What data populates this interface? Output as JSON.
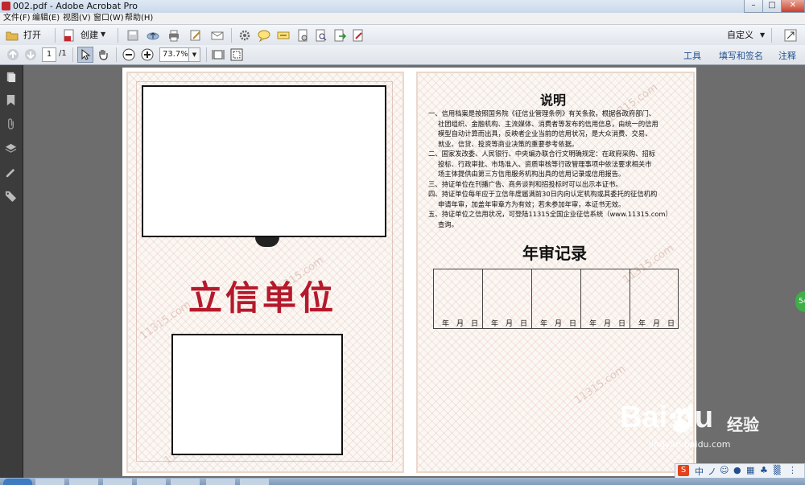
{
  "window": {
    "title": "002.pdf - Adobe Acrobat Pro"
  },
  "menu": [
    "文件(F)",
    "编辑(E)",
    "视图(V)",
    "窗口(W)",
    "帮助(H)"
  ],
  "toolbar": {
    "open_label": "打开",
    "create_label": "创建",
    "customize_label": "自定义"
  },
  "nav": {
    "page_current": "1",
    "page_total": "/1",
    "zoom": "73.7%"
  },
  "panels": {
    "tools": "工具",
    "fill_sign": "填写和签名",
    "comment": "注释"
  },
  "certificate_left": {
    "title": "立信单位",
    "watermark": "11315.com"
  },
  "certificate_right": {
    "heading": "说明",
    "items": [
      "一、信用档案是按照国务院《征信业管理条例》有关条款，根据各政府部门、",
      "社团组织、金融机构、主流媒体、消费者等发布的信用信息，由统一的信用",
      "模型自动计算而出具，反映者企业当前的信用状况，是大众消费、交易、",
      "就业、信贷、投资等商业决策的重要参考依据。",
      "二、国家发改委、人民银行、中央编办联合行文明确规定：在政府采购、招标",
      "投标、行政审批、市场准入、资质审核等行政管理事项中依法要求相关市",
      "场主体提供由第三方信用服务机构出具的信用记录或信用报告。",
      "三、持证单位在刊播广告、商务谈判和招投标时可以出示本证书。",
      "四、持证单位每年应于立信年度届满前30日内向认定机构或其委托的征信机构",
      "申请年审，加盖年审章方为有效；若未参加年审，本证书无效。",
      "五、持证单位之信用状况，可登陆11315全国企业征信系统（www.11315.com）",
      "查询。"
    ],
    "annual_title": "年审记录",
    "date_label": "年　月　日"
  },
  "watermark": {
    "logo": "Bai  du",
    "cn": "经验",
    "url": "jingyan.baidu.com"
  },
  "colors": {
    "accent_red": "#b5192b",
    "sidebar": "#3c3c3c",
    "link": "#1f4f8f"
  }
}
